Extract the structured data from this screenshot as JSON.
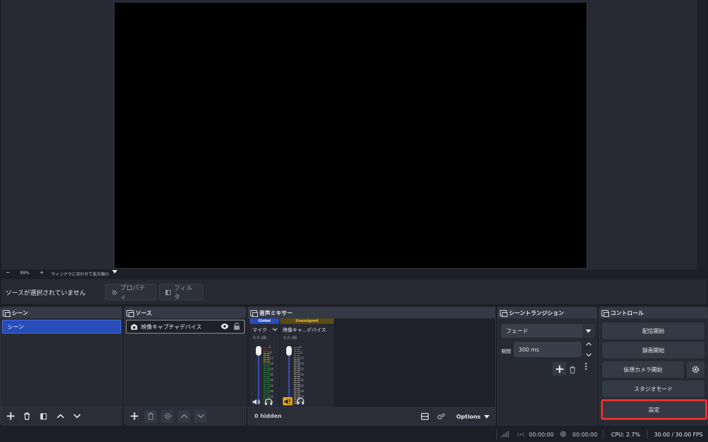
{
  "preview": {
    "zoom_minus": "−",
    "zoom_percent": "99%",
    "zoom_plus": "+",
    "zoom_fit": "ウィンドウに合わせて拡大縮小"
  },
  "context": {
    "status": "ソースが選択されていません",
    "properties": "プロパティ",
    "filters": "フィルタ"
  },
  "scenes": {
    "title": "シーン",
    "items": [
      "シーン"
    ]
  },
  "sources": {
    "title": "ソース",
    "items": [
      "映像キャプチャデバイス"
    ]
  },
  "mixer": {
    "title": "音声ミキサー",
    "channels": [
      {
        "tag": "Global",
        "name": "マイク",
        "db": "0.0 dB"
      },
      {
        "tag": "Unassigned",
        "name": "映像キャ...デバイス",
        "db": "0.0 dB"
      }
    ],
    "scale": [
      "0",
      "-6",
      "-12",
      "-18",
      "-24",
      "-30",
      "-36",
      "-42",
      "-48",
      "-54",
      "-60"
    ],
    "hidden": "0 hidden",
    "options": "Options"
  },
  "transitions": {
    "title": "シーントランジション",
    "selected": "フェード",
    "duration_label": "期間",
    "duration_value": "300 ms"
  },
  "controls": {
    "title": "コントロール",
    "start_streaming": "配信開始",
    "start_recording": "録画開始",
    "start_virtual_camera": "仮想カメラ開始",
    "studio_mode": "スタジオモード",
    "settings": "設定"
  },
  "status": {
    "live_time": "00:00:00",
    "rec_time": "00:00:00",
    "cpu": "CPU: 2.7%",
    "fps": "30.00 / 30.00 FPS"
  },
  "colors": {
    "accent": "#284cb8",
    "highlight": "#e8302f",
    "warning": "#e0a020"
  }
}
